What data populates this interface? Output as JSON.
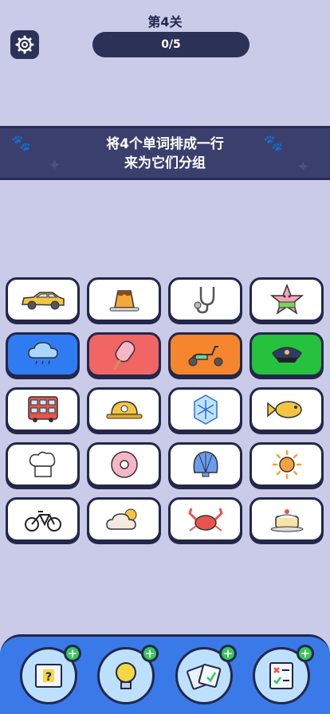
{
  "header": {
    "level_title": "第4关",
    "progress_text": "0/5"
  },
  "banner": {
    "line1": "将4个单词排成一行",
    "line2": "来为它们分组"
  },
  "tiles": [
    {
      "icon": "car-icon",
      "bg": "#ffffff"
    },
    {
      "icon": "pudding-icon",
      "bg": "#ffffff"
    },
    {
      "icon": "stethoscope-icon",
      "bg": "#ffffff"
    },
    {
      "icon": "starfish-icon",
      "bg": "#ffffff"
    },
    {
      "icon": "rain-cloud-icon",
      "bg": "#2f7bf2"
    },
    {
      "icon": "popsicle-icon",
      "bg": "#f26565"
    },
    {
      "icon": "scooter-icon",
      "bg": "#f5862d"
    },
    {
      "icon": "police-cap-icon",
      "bg": "#26c23e"
    },
    {
      "icon": "bus-icon",
      "bg": "#ffffff"
    },
    {
      "icon": "hard-hat-icon",
      "bg": "#ffffff"
    },
    {
      "icon": "snowflake-icon",
      "bg": "#ffffff"
    },
    {
      "icon": "fish-icon",
      "bg": "#ffffff"
    },
    {
      "icon": "chef-hat-icon",
      "bg": "#ffffff"
    },
    {
      "icon": "donut-icon",
      "bg": "#ffffff"
    },
    {
      "icon": "shell-icon",
      "bg": "#ffffff"
    },
    {
      "icon": "sun-icon",
      "bg": "#ffffff"
    },
    {
      "icon": "bicycle-icon",
      "bg": "#ffffff"
    },
    {
      "icon": "partly-cloudy-icon",
      "bg": "#ffffff"
    },
    {
      "icon": "crab-icon",
      "bg": "#ffffff"
    },
    {
      "icon": "cake-icon",
      "bg": "#ffffff"
    }
  ],
  "powerups": [
    {
      "icon": "hint-card-icon"
    },
    {
      "icon": "lightbulb-icon"
    },
    {
      "icon": "cards-icon"
    },
    {
      "icon": "checklist-icon"
    }
  ]
}
